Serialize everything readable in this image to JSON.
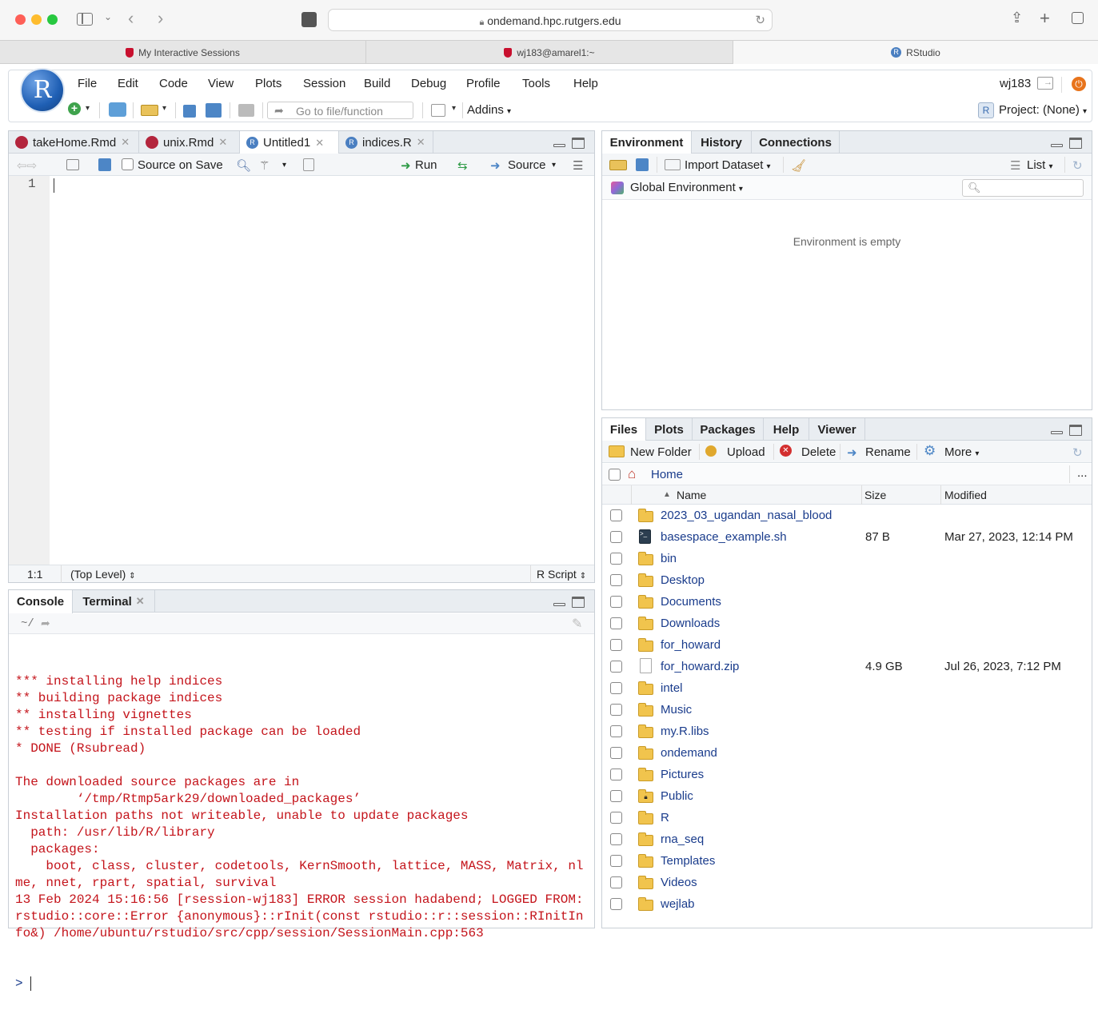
{
  "browser": {
    "url": "ondemand.hpc.rutgers.edu",
    "tabs": [
      {
        "label": "My Interactive Sessions"
      },
      {
        "label": "wj183@amarel1:~"
      },
      {
        "label": "RStudio"
      }
    ]
  },
  "rstudio": {
    "logo_letter": "R",
    "menu": [
      "File",
      "Edit",
      "Code",
      "View",
      "Plots",
      "Session",
      "Build",
      "Debug",
      "Profile",
      "Tools",
      "Help"
    ],
    "user": "wj183",
    "goto_placeholder": "Go to file/function",
    "addins_label": "Addins",
    "project_label": "Project: (None)"
  },
  "editor": {
    "tabs": [
      {
        "label": "takeHome.Rmd",
        "icon": "rmd-icon"
      },
      {
        "label": "unix.Rmd",
        "icon": "rmd-icon"
      },
      {
        "label": "Untitled1",
        "icon": "r-file-icon"
      },
      {
        "label": "indices.R",
        "icon": "r-file-icon"
      }
    ],
    "source_on_save": "Source on Save",
    "run_label": "Run",
    "source_label": "Source",
    "line_number": "1",
    "status_position": "1:1",
    "status_scope": "(Top Level)",
    "status_filetype": "R Script"
  },
  "console": {
    "tabs": [
      {
        "label": "Console"
      },
      {
        "label": "Terminal"
      }
    ],
    "path": "~/",
    "lines": [
      "*** installing help indices",
      "** building package indices",
      "** installing vignettes",
      "** testing if installed package can be loaded",
      "* DONE (Rsubread)",
      "",
      "The downloaded source packages are in",
      "\t‘/tmp/Rtmp5ark29/downloaded_packages’",
      "Installation paths not writeable, unable to update packages",
      "  path: /usr/lib/R/library",
      "  packages:",
      "    boot, class, cluster, codetools, KernSmooth, lattice, MASS, Matrix, nlme, nnet, rpart, spatial, survival",
      "13 Feb 2024 15:16:56 [rsession-wj183] ERROR session hadabend; LOGGED FROM: rstudio::core::Error {anonymous}::rInit(const rstudio::r::session::RInitInfo&) /home/ubuntu/rstudio/src/cpp/session/SessionMain.cpp:563"
    ],
    "prompt": ">"
  },
  "environment": {
    "tabs": [
      {
        "label": "Environment"
      },
      {
        "label": "History"
      },
      {
        "label": "Connections"
      }
    ],
    "import_label": "Import Dataset",
    "list_label": "List",
    "scope_label": "Global Environment",
    "empty_message": "Environment is empty"
  },
  "files": {
    "tabs": [
      {
        "label": "Files"
      },
      {
        "label": "Plots"
      },
      {
        "label": "Packages"
      },
      {
        "label": "Help"
      },
      {
        "label": "Viewer"
      }
    ],
    "actions": {
      "new_folder": "New Folder",
      "upload": "Upload",
      "delete": "Delete",
      "rename": "Rename",
      "more": "More"
    },
    "breadcrumb": "Home",
    "more_dots": "...",
    "columns": {
      "name": "Name",
      "size": "Size",
      "modified": "Modified"
    },
    "rows": [
      {
        "name": "2023_03_ugandan_nasal_blood",
        "type": "folder",
        "size": "",
        "modified": ""
      },
      {
        "name": "basespace_example.sh",
        "type": "script",
        "size": "87 B",
        "modified": "Mar 27, 2023, 12:14 PM"
      },
      {
        "name": "bin",
        "type": "folder",
        "size": "",
        "modified": ""
      },
      {
        "name": "Desktop",
        "type": "folder",
        "size": "",
        "modified": ""
      },
      {
        "name": "Documents",
        "type": "folder",
        "size": "",
        "modified": ""
      },
      {
        "name": "Downloads",
        "type": "folder",
        "size": "",
        "modified": ""
      },
      {
        "name": "for_howard",
        "type": "folder",
        "size": "",
        "modified": ""
      },
      {
        "name": "for_howard.zip",
        "type": "file",
        "size": "4.9 GB",
        "modified": "Jul 26, 2023, 7:12 PM"
      },
      {
        "name": "intel",
        "type": "folder",
        "size": "",
        "modified": ""
      },
      {
        "name": "Music",
        "type": "folder",
        "size": "",
        "modified": ""
      },
      {
        "name": "my.R.libs",
        "type": "folder",
        "size": "",
        "modified": ""
      },
      {
        "name": "ondemand",
        "type": "folder",
        "size": "",
        "modified": ""
      },
      {
        "name": "Pictures",
        "type": "folder",
        "size": "",
        "modified": ""
      },
      {
        "name": "Public",
        "type": "folder-public",
        "size": "",
        "modified": ""
      },
      {
        "name": "R",
        "type": "folder",
        "size": "",
        "modified": ""
      },
      {
        "name": "rna_seq",
        "type": "folder",
        "size": "",
        "modified": ""
      },
      {
        "name": "Templates",
        "type": "folder",
        "size": "",
        "modified": ""
      },
      {
        "name": "Videos",
        "type": "folder",
        "size": "",
        "modified": ""
      },
      {
        "name": "wejlab",
        "type": "folder",
        "size": "",
        "modified": ""
      }
    ]
  },
  "colors": {
    "console_text": "#c4141b",
    "link": "#1a3c8c",
    "r_logo": "#1f5fb4",
    "power": "#e8741c"
  }
}
